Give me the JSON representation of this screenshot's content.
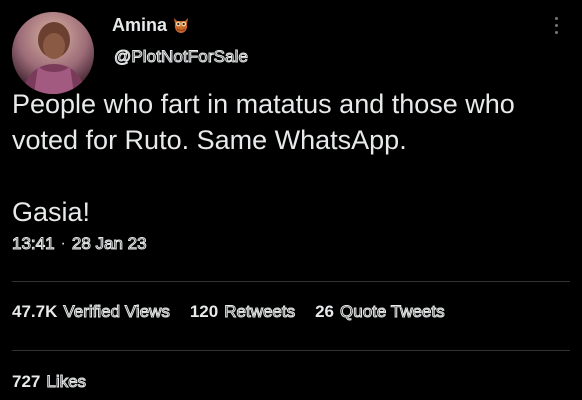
{
  "author": {
    "display_name": "Amina",
    "name_emoji": "owl-emoji",
    "handle": "@PlotNotForSale",
    "avatar": "profile-photo"
  },
  "tweet": {
    "line1": "People who fart in matatus and those who voted for Ruto. Same WhatsApp.",
    "line2": "Gasia!",
    "time": "13:41",
    "separator": "·",
    "date": "28 Jan 23"
  },
  "stats": {
    "views_count": "47.7K",
    "views_label": "Verified Views",
    "retweets_count": "120",
    "retweets_label": "Retweets",
    "quotes_count": "26",
    "quotes_label": "Quote Tweets",
    "likes_count": "727",
    "likes_label": "Likes"
  },
  "colors": {
    "background": "#000000",
    "text": "#e7e9ea",
    "muted": "#71767b",
    "divider": "#2f3336"
  }
}
